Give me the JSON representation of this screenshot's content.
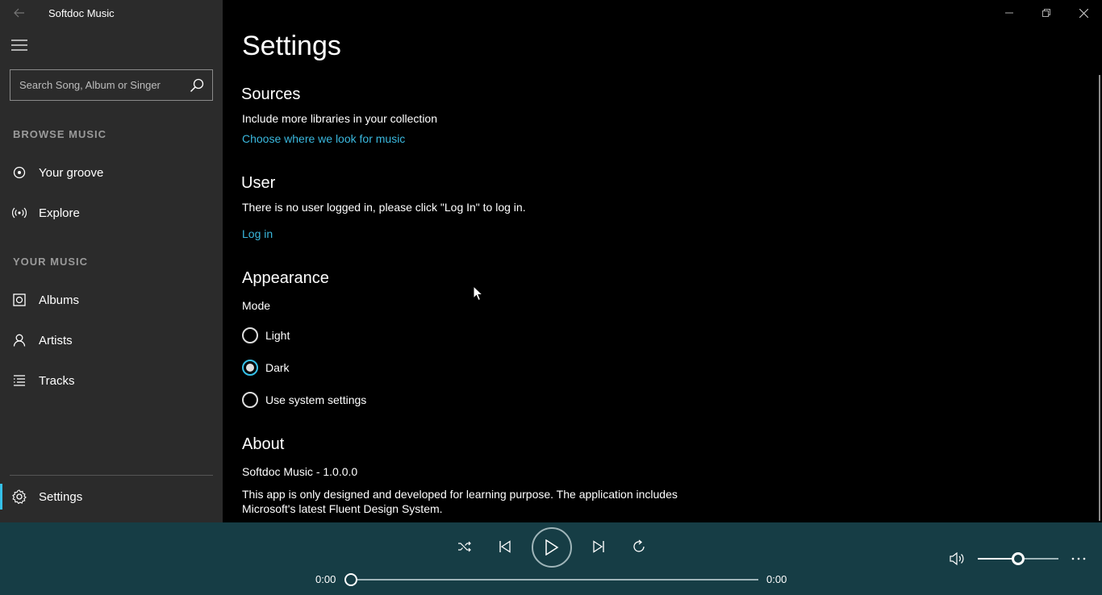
{
  "app": {
    "title": "Softdoc Music"
  },
  "search": {
    "placeholder": "Search Song, Album or Singer"
  },
  "sidebar": {
    "browse_header": "BROWSE MUSIC",
    "browse_items": [
      {
        "label": "Your groove",
        "icon": "groove-icon"
      },
      {
        "label": "Explore",
        "icon": "radio-waves-icon"
      }
    ],
    "your_music_header": "YOUR MUSIC",
    "your_music_items": [
      {
        "label": "Albums",
        "icon": "album-icon"
      },
      {
        "label": "Artists",
        "icon": "person-icon"
      },
      {
        "label": "Tracks",
        "icon": "list-icon"
      }
    ],
    "settings_label": "Settings"
  },
  "main": {
    "title": "Settings",
    "sources": {
      "heading": "Sources",
      "description": "Include more libraries in your collection",
      "link": "Choose where we look for music"
    },
    "user": {
      "heading": "User",
      "description": "There is no user logged in, please click \"Log In\" to log in.",
      "link": "Log in"
    },
    "appearance": {
      "heading": "Appearance",
      "mode_label": "Mode",
      "options": [
        {
          "label": "Light",
          "selected": false
        },
        {
          "label": "Dark",
          "selected": true
        },
        {
          "label": "Use system settings",
          "selected": false
        }
      ]
    },
    "about": {
      "heading": "About",
      "version": "Softdoc Music - 1.0.0.0",
      "description_line1": "This app is only designed and developed for learning purpose. The application includes",
      "description_line2": "Microsoft's latest Fluent Design System."
    }
  },
  "player": {
    "current_time": "0:00",
    "total_time": "0:00",
    "progress": 0,
    "volume": 0.5
  },
  "colors": {
    "accent": "#35c0e8",
    "link": "#3ab8de",
    "sidebar_bg": "#2b2b2b",
    "player_bg": "#163d45"
  }
}
